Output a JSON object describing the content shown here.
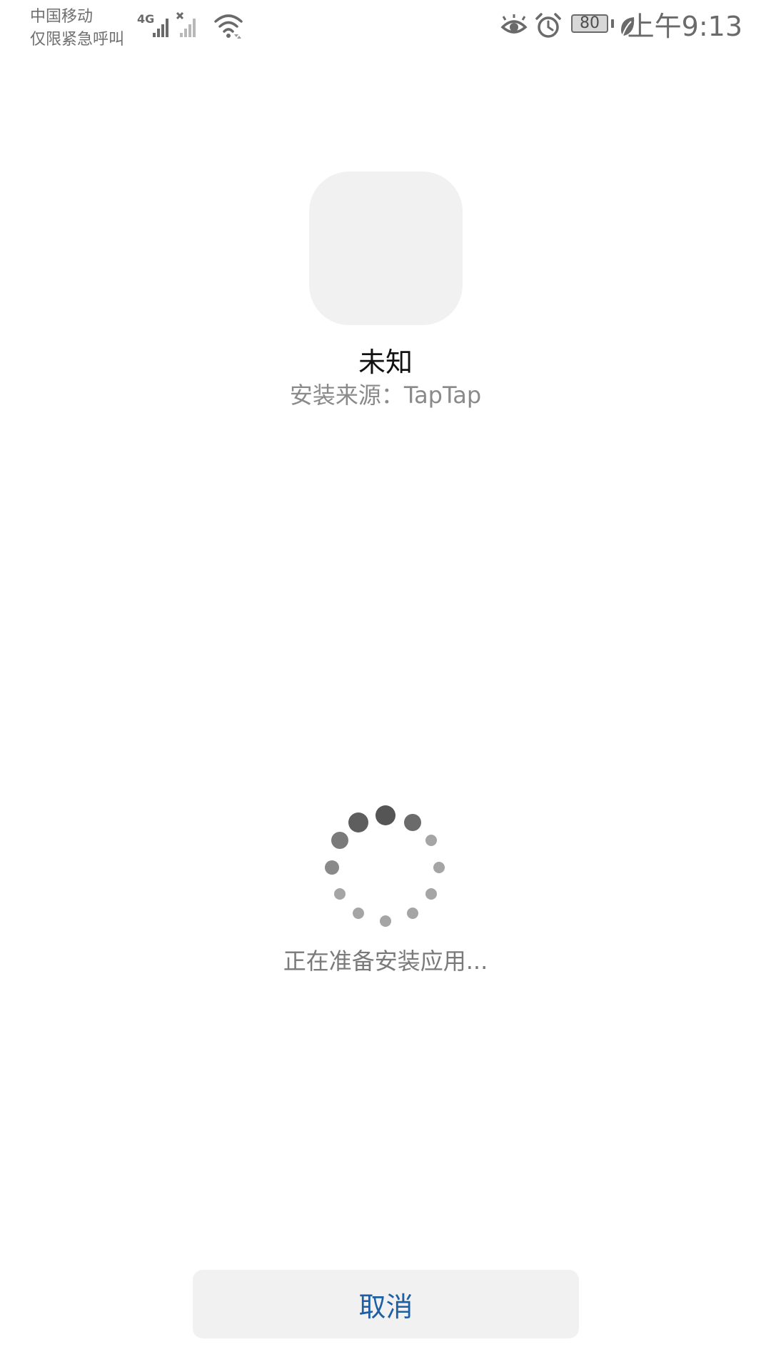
{
  "status_bar": {
    "carrier_line1": "中国移动",
    "carrier_line2": "仅限紧急呼叫",
    "network_type": "4G",
    "battery_level": "80",
    "time": "上午9:13",
    "icons": [
      "signal-4g-icon",
      "signal-no-service-icon",
      "wifi-icon",
      "eye-icon",
      "alarm-icon",
      "battery-icon",
      "leaf-icon"
    ]
  },
  "app": {
    "name": "未知",
    "install_source": "安装来源：TapTap"
  },
  "progress": {
    "status_text": "正在准备安装应用..."
  },
  "actions": {
    "cancel_label": "取消"
  },
  "colors": {
    "accent": "#1e5fa3",
    "button_bg": "#f1f1f1",
    "icon_placeholder": "#f1f1f1"
  }
}
